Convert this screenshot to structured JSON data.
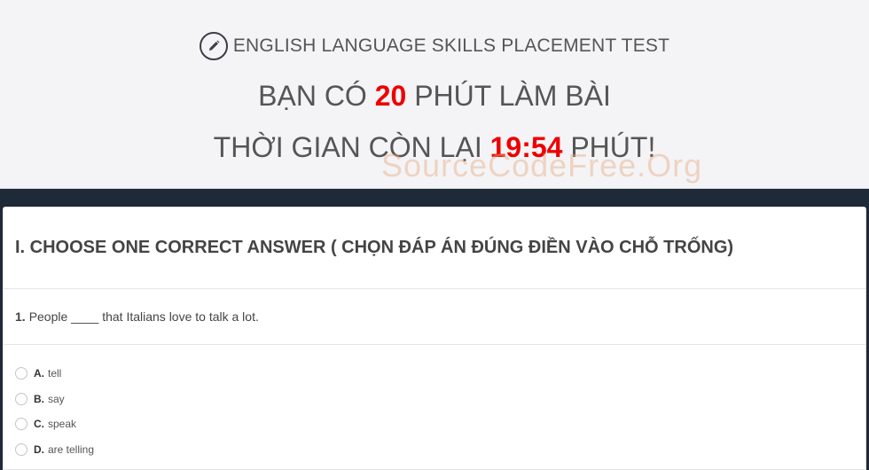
{
  "header": {
    "test_title": "ENGLISH LANGUAGE SKILLS PLACEMENT TEST",
    "line1_prefix": "BẠN CÓ",
    "line1_number": "20",
    "line1_suffix": "PHÚT LÀM BÀI",
    "line2_prefix": "THỜI GIAN CÒN LẠI",
    "line2_timer": "19:54",
    "line2_suffix": "PHÚT!",
    "watermark": "SourceCodeFree.Org",
    "icon": "pencil-icon"
  },
  "section": {
    "title": "I. CHOOSE ONE CORRECT ANSWER ( CHỌN ĐÁP ÁN ĐÚNG ĐIỀN VÀO CHỖ TRỐNG)"
  },
  "question": {
    "number": "1.",
    "text": "People ____ that Italians love to talk a lot.",
    "options": [
      {
        "letter": "A.",
        "text": "tell"
      },
      {
        "letter": "B.",
        "text": "say"
      },
      {
        "letter": "C.",
        "text": "speak"
      },
      {
        "letter": "D.",
        "text": "are telling"
      }
    ]
  },
  "colors": {
    "accent_red": "#ee0000",
    "dark_band": "#1f2a38",
    "header_bg": "#f4f4f6"
  }
}
